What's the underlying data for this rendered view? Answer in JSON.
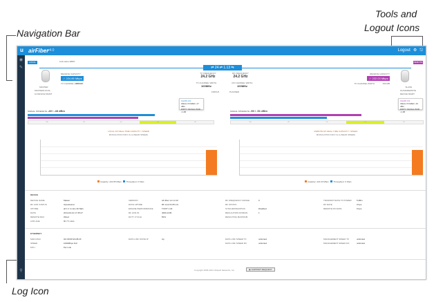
{
  "callouts": {
    "navigation_bar": "Navigation Bar",
    "tools_logout_line1": "Tools and",
    "tools_logout_line2": "Logout Icons",
    "log_icon": "Log Icon"
  },
  "topbar": {
    "brand": "airFiber",
    "version": "v4.0",
    "logout": "Logout"
  },
  "link": {
    "label": "⇄ 24 ⇄ 1.13 ⇆",
    "local_tag": "LOCAL",
    "remote_tag": "REMOTE",
    "device_name": "Link name 48W7"
  },
  "local": {
    "capacity_label": "RECEIVE CAPACITY",
    "capacity_value": "↓↑ 224.85 Mbps",
    "role": "MASTER/LOCAL",
    "mode": "MASTER",
    "ip_label": "10 DEVICE MGMT",
    "tx_label": "TX CHANNEL WIDTH",
    "tx_value": "250 MB"
  },
  "remote": {
    "capacity_label": "RECEIVE CAPACITY",
    "capacity_value": "↓↑ 222.03 Mbps",
    "role": "SLAVE/REMOTE",
    "mode": "SLAVE",
    "ip_label": "DEVICE MGMT",
    "tx_label": "TX CHANNEL WIDTH",
    "tx_value": "250 MB"
  },
  "center": {
    "tx_freq_label": "TX FREQUENCY",
    "tx_freq_value": "24.2 GHz",
    "rx_freq_label": "RX FREQUENCY",
    "rx_freq_value": "24.2 GHz",
    "tx_width_label": "TX CHANNEL WIDTH",
    "tx_width_value": "100MHz",
    "rx_width_label": "RX CHANNEL WIDTH",
    "rx_width_value": "100MHz",
    "duplex_label": "FDD/1/0",
    "status_label": "PLANNED"
  },
  "signal": {
    "local_label": "SIGNAL STRENGTH",
    "local_value": "-49 / -48 dBm",
    "remote_label": "SIGNAL STRENGTH",
    "remote_value": "-50 / -51 dBm",
    "popup_local": [
      "CHAIN 0/1",
      "IDEAL POWER -47 dBm",
      "DIRTY SIGNAL/SNR -1 dB"
    ],
    "popup_remote": [
      "CHAIN 0/1",
      "IDEAL POWER -49 dBm",
      "DIRTY SIGNAL/SNR -1 dB"
    ],
    "scale": [
      "-100",
      "-80",
      "-60",
      "-50",
      "-40"
    ]
  },
  "charts": {
    "local_title": "LOCAL RX REAL-TIME CAPACITY / SPEED",
    "local_subtitle": "MODULATION INFO 4x (LINEAR SPEED)",
    "remote_title": "REMOTE RX REAL-TIME CAPACITY / SPEED",
    "remote_subtitle": "MODULATION INFO 4x (LINEAR SPEED)",
    "local_legend_a": "Capacity: 224.85 Mbps",
    "local_legend_b": "Throughput: 0 Kbps",
    "remote_legend_a": "Capacity: 222.03 Mbps",
    "remote_legend_b": "Throughput: 0 Kbps",
    "y_ticks": [
      "250",
      "200",
      "150",
      "100",
      "50",
      "0"
    ],
    "colors": {
      "capacity": "#f47b20",
      "throughput": "#1d8ed9"
    }
  },
  "device": {
    "title": "DEVICE",
    "col1": [
      [
        "DEVICE NAME",
        "Master"
      ],
      [
        "RF LINK STATUS",
        "Operational"
      ],
      [
        "UPTIME",
        "all 1 h 4 mins 30 SEC"
      ],
      [
        "DATE",
        "2014-02-10 17:45:27"
      ],
      [
        "REMOTE MAC",
        "Wired"
      ],
      [
        "LINK AGE",
        "0h 7 h mins"
      ]
    ],
    "col2": [
      [
        "VERSION",
        "AF-fiber v2.1.0.10"
      ],
      [
        "DATE UPTIME",
        "RF Link 0h 05 min"
      ],
      [
        "ENGINE PERFORMANCE",
        "TX/OT 1.04"
      ],
      [
        "RF LINK ID",
        "4000-1245"
      ],
      [
        "DUTY CYCLE",
        "50%"
      ]
    ],
    "col3": [
      [
        "RF FREQUENCY RANGE",
        "0"
      ],
      [
        "RF STATUS",
        ""
      ],
      [
        "SYNCHRONIZATION",
        "Disabled"
      ],
      [
        "REGULATION DOMAIN",
        "1"
      ],
      [
        "RESULTING MAXIMUM",
        ""
      ]
    ],
    "col4": [
      [
        "TRANSMIT RATE TX POWER",
        "5 dBm"
      ],
      [
        "RX RATE",
        "0 bps"
      ],
      [
        "REMOTE RX RATE",
        "0 bps"
      ]
    ]
  },
  "ethernet": {
    "title": "ETHERNET",
    "col1": [
      [
        "MAIN MAC",
        "04:18:D6:6A:D8:2F"
      ],
      [
        "SPEED",
        "1000Mbps Full"
      ],
      [
        "MTU",
        "Per Link"
      ]
    ],
    "col2": [
      [
        "DATA LINK STATE IP",
        "Up"
      ]
    ],
    "col3": [
      [
        "DATA LINK SPEED TX",
        "unlimited"
      ],
      [
        "DATA LINK SPEED RX",
        "unlimited"
      ]
    ],
    "col4": [
      [
        "MANAGEMENT SPEED TX",
        "unlimited"
      ],
      [
        "MANAGEMENT SPEED RX",
        "unlimited"
      ]
    ]
  },
  "footer": {
    "copyright": "Copyright 2006-2014 Ubiquiti Networks, Inc.",
    "support_button": "▶ SUPPORT REQUEST"
  }
}
